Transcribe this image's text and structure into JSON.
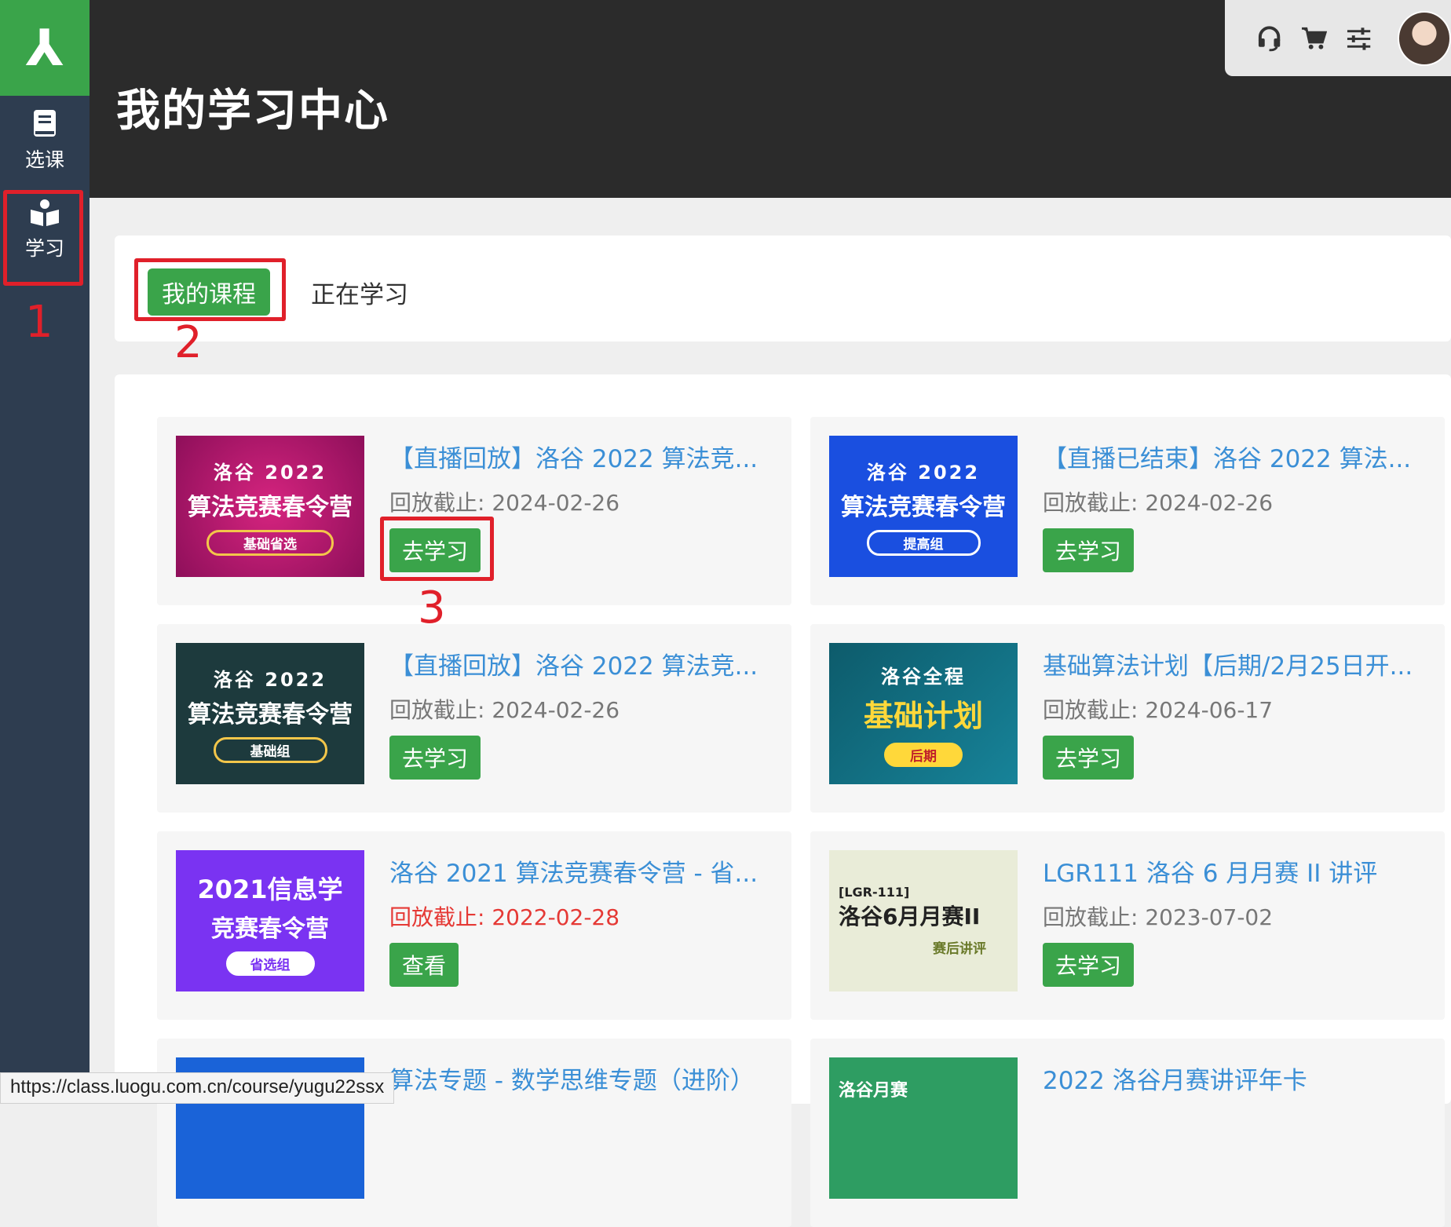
{
  "sidebar": {
    "logo": "⅄",
    "items": [
      {
        "label": "选课",
        "icon": "book-icon"
      },
      {
        "label": "学习",
        "icon": "open-book-icon"
      }
    ]
  },
  "header": {
    "title": "我的学习中心",
    "icons": [
      "headset-icon",
      "cart-icon",
      "sliders-icon",
      "avatar"
    ]
  },
  "tabs": [
    {
      "label": "我的课程",
      "active": true
    },
    {
      "label": "正在学习",
      "active": false
    }
  ],
  "annotations": [
    "1",
    "2",
    "3"
  ],
  "courses": [
    {
      "title": "【直播回放】洛谷 2022 算法竞...",
      "date": "回放截止: 2024-02-26",
      "expired": false,
      "button": "去学习",
      "thumb": {
        "l1": "洛谷 2022",
        "l2": "算法竞赛春令营",
        "pill": "基础省选",
        "bg": "#b4176f"
      }
    },
    {
      "title": "【直播已结束】洛谷 2022 算法...",
      "date": "回放截止: 2024-02-26",
      "expired": false,
      "button": "去学习",
      "thumb": {
        "l1": "洛谷 2022",
        "l2": "算法竞赛春令营",
        "pill": "提高组",
        "bg": "#1a4fe0"
      }
    },
    {
      "title": "【直播回放】洛谷 2022 算法竞...",
      "date": "回放截止: 2024-02-26",
      "expired": false,
      "button": "去学习",
      "thumb": {
        "l1": "洛谷 2022",
        "l2": "算法竞赛春令营",
        "pill": "基础组",
        "bg": "#1d3a3d"
      }
    },
    {
      "title": "基础算法计划【后期/2月25日开...",
      "date": "回放截止: 2024-06-17",
      "expired": false,
      "button": "去学习",
      "thumb": {
        "l1": "洛谷全程",
        "l2": "基础计划",
        "pill": "后期",
        "bg": "#13697a"
      }
    },
    {
      "title": "洛谷 2021 算法竞赛春令营 - 省...",
      "date": "回放截止: 2022-02-28",
      "expired": true,
      "button": "查看",
      "thumb": {
        "l1": "2021信息学",
        "l2": "竞赛春令营",
        "pill": "省选组",
        "bg": "#7a33f2"
      }
    },
    {
      "title": "LGR111 洛谷 6 月月赛 II 讲评",
      "date": "回放截止: 2023-07-02",
      "expired": false,
      "button": "去学习",
      "thumb": {
        "l1": "[LGR-111]",
        "l2": "洛谷6月月赛II",
        "pill": "赛后讲评",
        "bg": "#e9ecd8"
      }
    },
    {
      "title": "算法专题 - 数学思维专题（进阶）",
      "date": "",
      "expired": false,
      "button": "",
      "thumb": {
        "l1": "",
        "l2": "",
        "pill": "",
        "bg": "#1a63d8"
      }
    },
    {
      "title": "2022 洛谷月赛讲评年卡",
      "date": "",
      "expired": false,
      "button": "",
      "thumb": {
        "l1": "洛谷月赛",
        "l2": "",
        "pill": "",
        "bg": "#2e9d62"
      }
    }
  ],
  "status_url": "https://class.luogu.com.cn/course/yugu22ssx"
}
